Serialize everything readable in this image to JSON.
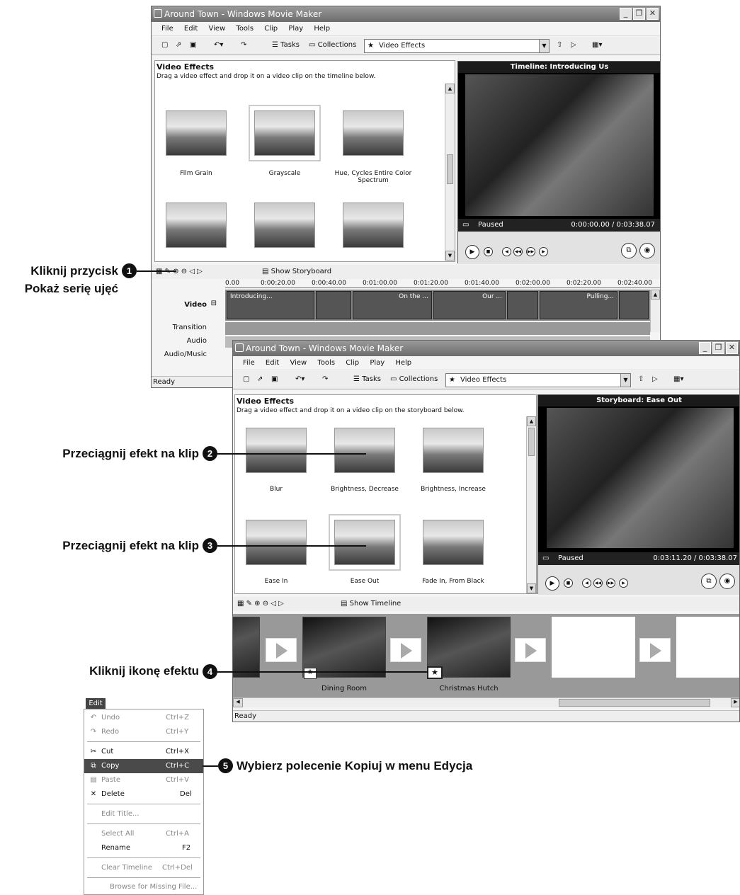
{
  "window1": {
    "title": "Around Town - Windows Movie Maker",
    "menu": [
      "File",
      "Edit",
      "View",
      "Tools",
      "Clip",
      "Play",
      "Help"
    ],
    "toolbar": {
      "tasks": "Tasks",
      "collections": "Collections",
      "combo": "Video Effects"
    },
    "panel_title": "Video Effects",
    "panel_desc": "Drag a video effect and drop it on a video clip on the timeline below.",
    "effects": [
      "Film Grain",
      "Grayscale",
      "Hue, Cycles Entire Color Spectrum"
    ],
    "preview_title": "Timeline: Introducing Us",
    "preview_status": "Paused",
    "preview_time": "0:00:00.00 / 0:03:38.07",
    "timeline_toggle": "Show Storyboard",
    "ruler": [
      "0.00",
      "0:00:20.00",
      "0:00:40.00",
      "0:01:00.00",
      "0:01:20.00",
      "0:01:40.00",
      "0:02:00.00",
      "0:02:20.00",
      "0:02:40.00"
    ],
    "tracks": [
      "Video",
      "Transition",
      "Audio",
      "Audio/Music"
    ],
    "clips": [
      "Introducing...",
      "On the ...",
      "Our ...",
      "Pulling..."
    ],
    "status": "Ready"
  },
  "window2": {
    "title": "Around Town - Windows Movie Maker",
    "menu": [
      "File",
      "Edit",
      "View",
      "Tools",
      "Clip",
      "Play",
      "Help"
    ],
    "toolbar": {
      "tasks": "Tasks",
      "collections": "Collections",
      "combo": "Video Effects"
    },
    "panel_title": "Video Effects",
    "panel_desc": "Drag a video effect and drop it on a video clip on the storyboard below.",
    "effects": [
      "Blur",
      "Brightness, Decrease",
      "Brightness, Increase",
      "Ease In",
      "Ease Out",
      "Fade In, From Black"
    ],
    "preview_title": "Storyboard: Ease Out",
    "preview_status": "Paused",
    "preview_time": "0:03:11.20 / 0:03:38.07",
    "timeline_toggle": "Show Timeline",
    "storyboard_clips": [
      "Dining Room",
      "Christmas Hutch"
    ],
    "status": "Ready"
  },
  "edit_menu": {
    "title": "Edit",
    "items": [
      {
        "label": "Undo",
        "shortcut": "Ctrl+Z"
      },
      {
        "label": "Redo",
        "shortcut": "Ctrl+Y"
      },
      {
        "label": "Cut",
        "shortcut": "Ctrl+X"
      },
      {
        "label": "Copy",
        "shortcut": "Ctrl+C"
      },
      {
        "label": "Paste",
        "shortcut": "Ctrl+V"
      },
      {
        "label": "Delete",
        "shortcut": "Del"
      },
      {
        "label": "Edit Title...",
        "shortcut": ""
      },
      {
        "label": "Select All",
        "shortcut": "Ctrl+A"
      },
      {
        "label": "Rename",
        "shortcut": "F2"
      },
      {
        "label": "Clear Timeline",
        "shortcut": "Ctrl+Del"
      },
      {
        "label": "Browse for Missing File...",
        "shortcut": ""
      }
    ]
  },
  "callouts": [
    {
      "num": "1",
      "text": "Kliknij przycisk",
      "text2": "Pokaż serię ujęć"
    },
    {
      "num": "2",
      "text": "Przeciągnij efekt na klip"
    },
    {
      "num": "3",
      "text": "Przeciągnij efekt na klip"
    },
    {
      "num": "4",
      "text": "Kliknij ikonę efektu"
    },
    {
      "num": "5",
      "text": "Wybierz polecenie Kopiuj w menu Edycja"
    }
  ],
  "colors": {
    "titlebar": "#7a7a7a",
    "highlight": "#4a4a4a",
    "preview_bg": "#000000"
  }
}
